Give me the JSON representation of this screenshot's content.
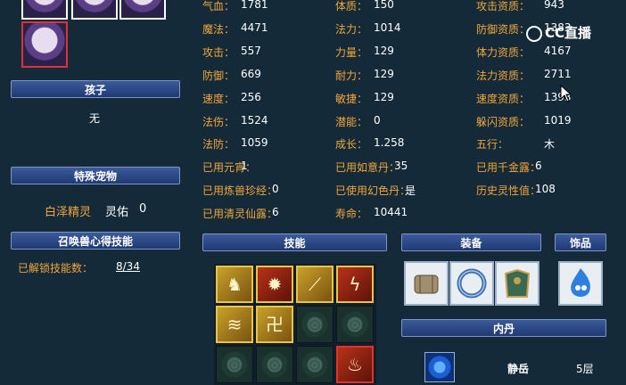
{
  "stats_col1": [
    {
      "label": "气血：",
      "value": "1781"
    },
    {
      "label": "魔法：",
      "value": "4471"
    },
    {
      "label": "攻击：",
      "value": "557"
    },
    {
      "label": "防御：",
      "value": "669"
    },
    {
      "label": "速度：",
      "value": "256"
    },
    {
      "label": "法伤：",
      "value": "1524"
    },
    {
      "label": "法防：",
      "value": "1059"
    },
    {
      "label": "已用元宵：",
      "value": "1"
    },
    {
      "label": "已用炼兽珍经：",
      "value": "0"
    },
    {
      "label": "已用清灵仙露：",
      "value": "6"
    }
  ],
  "stats_col2": [
    {
      "label": "体质：",
      "value": "150"
    },
    {
      "label": "法力：",
      "value": "1014"
    },
    {
      "label": "力量：",
      "value": "129"
    },
    {
      "label": "耐力：",
      "value": "129"
    },
    {
      "label": "敏捷：",
      "value": "129"
    },
    {
      "label": "潜能：",
      "value": "0"
    },
    {
      "label": "成长：",
      "value": "1.258"
    },
    {
      "label": "已用如意丹：",
      "value": "35"
    },
    {
      "label": "已使用幻色丹：",
      "value": "是"
    },
    {
      "label": "寿命：",
      "value": "10441"
    }
  ],
  "stats_col3": [
    {
      "label": "攻击资质：",
      "value": "943"
    },
    {
      "label": "防御资质：",
      "value": "1383"
    },
    {
      "label": "体力资质：",
      "value": "4167"
    },
    {
      "label": "法力资质：",
      "value": "2711"
    },
    {
      "label": "速度资质：",
      "value": "1393"
    },
    {
      "label": "躲闪资质：",
      "value": "1019"
    },
    {
      "label": "五行：",
      "value": "木"
    },
    {
      "label": "已用千金露：",
      "value": "6"
    },
    {
      "label": "历史灵性值：",
      "value": "108"
    }
  ],
  "child": {
    "header": "孩子",
    "value": "无"
  },
  "special": {
    "header": "特殊宠物",
    "name": "白泽精灵",
    "attr_label": "灵佑",
    "attr_value": "0"
  },
  "summon": {
    "header": "召唤兽心得技能",
    "unlocked_label": "已解锁技能数：",
    "unlocked_value": "8/34"
  },
  "sections": {
    "skills": "技能",
    "equipment": "装备",
    "accessory": "饰品",
    "neidan": "内丹"
  },
  "skills": [
    {
      "icon": "fire-beast-icon",
      "type": "skill"
    },
    {
      "icon": "burst-icon",
      "type": "skill red"
    },
    {
      "icon": "claw-slash-icon",
      "type": "skill"
    },
    {
      "icon": "lightning-icon",
      "type": "skill red"
    },
    {
      "icon": "wave-icon",
      "type": "skill"
    },
    {
      "icon": "rune-icon",
      "type": "skill"
    },
    {
      "icon": "empty-slot-icon",
      "type": "empty"
    },
    {
      "icon": "empty-slot-icon",
      "type": "empty"
    },
    {
      "icon": "empty-slot-icon",
      "type": "empty"
    },
    {
      "icon": "empty-slot-icon",
      "type": "empty"
    },
    {
      "icon": "empty-slot-icon",
      "type": "empty"
    },
    {
      "icon": "flame-icon",
      "type": "skill red hl"
    }
  ],
  "neidan_entry": {
    "name": "静岳",
    "level": "5层"
  },
  "watermark": "CC直播"
}
